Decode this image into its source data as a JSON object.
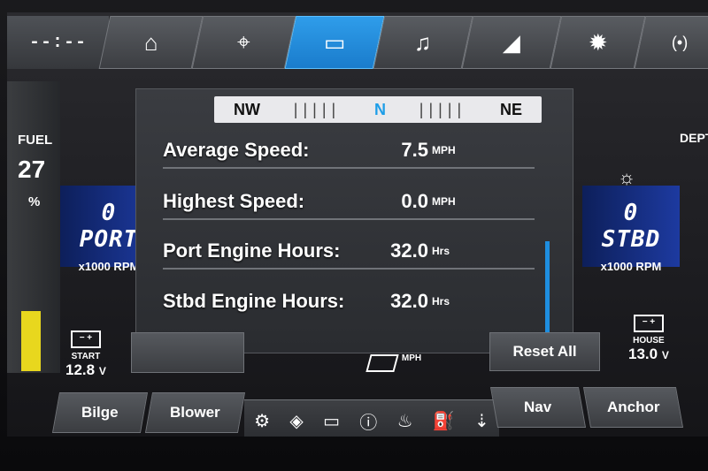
{
  "topbar": {
    "clock": "--:--",
    "tabs": [
      {
        "name": "home",
        "glyph": "⌂",
        "active": false
      },
      {
        "name": "map",
        "glyph": "⌖",
        "active": false
      },
      {
        "name": "gauges",
        "glyph": "▭",
        "active": true
      },
      {
        "name": "audio",
        "glyph": "♫",
        "active": false
      },
      {
        "name": "boat",
        "glyph": "◢",
        "active": false
      },
      {
        "name": "settings",
        "glyph": "✹",
        "active": false
      },
      {
        "name": "signal",
        "glyph": "(•)",
        "active": false
      }
    ]
  },
  "fuel": {
    "label": "FUEL",
    "value": "27",
    "unit": "%",
    "level_fraction": 0.27
  },
  "port": {
    "label": "PORT",
    "rpm_unit": "x1000 RPM"
  },
  "stbd": {
    "label": "STBD",
    "rpm_unit": "x1000 RPM"
  },
  "depth": {
    "label": "DEPT"
  },
  "start_battery": {
    "label": "START",
    "value": "12.8",
    "unit": "V"
  },
  "house_battery": {
    "label": "HOUSE",
    "value": "13.0",
    "unit": "V"
  },
  "compass": {
    "left": "NW",
    "center": "N",
    "right": "NE"
  },
  "stats": [
    {
      "label": "Average Speed:",
      "value": "7.5",
      "unit": "MPH"
    },
    {
      "label": "Highest Speed:",
      "value": "0.0",
      "unit": "MPH"
    },
    {
      "label": "Port Engine Hours:",
      "value": "32.0",
      "unit": "Hrs"
    },
    {
      "label": "Stbd Engine Hours:",
      "value": "32.0",
      "unit": "Hrs"
    }
  ],
  "speed_unit": "MPH",
  "buttons": {
    "reset_all": "Reset All",
    "bilge": "Bilge",
    "blower": "Blower",
    "nav": "Nav",
    "anchor": "Anchor"
  },
  "status_icons": [
    "engine-icon",
    "oil-icon",
    "battery-icon",
    "warning-icon",
    "temperature-icon",
    "fuel-pump-icon",
    "trim-icon"
  ],
  "colors": {
    "accent": "#1e9ee8",
    "rpm_panel": "#1d3aa0",
    "fuel_fill": "#e8d71e"
  }
}
